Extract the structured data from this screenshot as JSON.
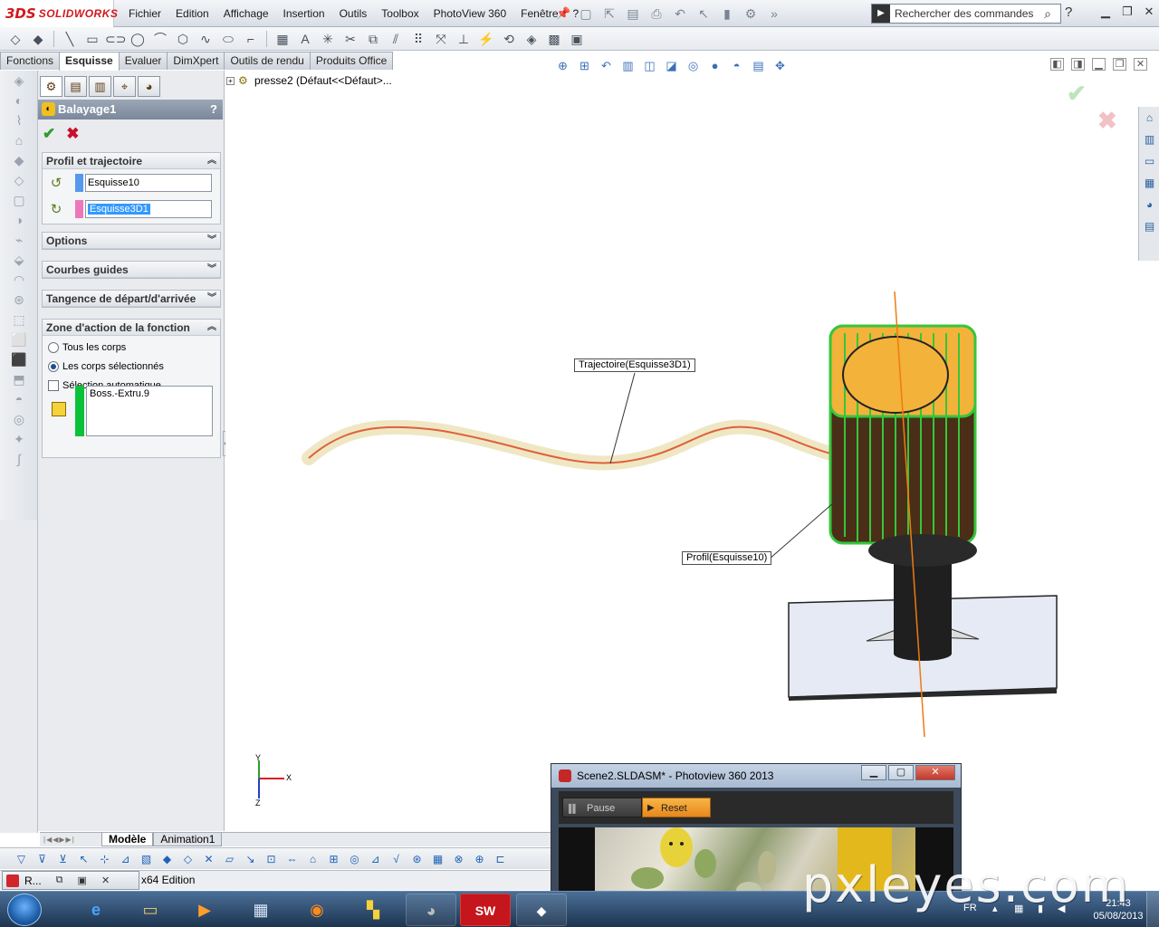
{
  "app": {
    "brand_prefix": "3DS",
    "brand_name": "SOLIDWORKS"
  },
  "menu": {
    "items": [
      "Fichier",
      "Edition",
      "Affichage",
      "Insertion",
      "Outils",
      "Toolbox",
      "PhotoView 360",
      "Fenêtre",
      "?"
    ],
    "more": "»"
  },
  "search": {
    "value": "Rechercher des commandes",
    "help_label": "?"
  },
  "tabs": [
    "Fonctions",
    "Esquisse",
    "Evaluer",
    "DimXpert",
    "Outils de rendu",
    "Produits Office"
  ],
  "active_tab": "Esquisse",
  "property_manager": {
    "title": "Balayage1",
    "help": "?",
    "ok": "✔",
    "cancel": "✖",
    "sections": {
      "profile_path": "Profil et trajectoire",
      "options": "Options",
      "guides": "Courbes guides",
      "tangency": "Tangence de départ/d'arrivée",
      "scope": "Zone d'action de la fonction"
    },
    "profile_value": "Esquisse10",
    "path_value": "Esquisse3D1",
    "profile_color": "#5599ee",
    "path_color": "#ee77bb",
    "scope_options": {
      "all": "Tous les corps",
      "selected": "Les corps sélectionnés",
      "auto": "Sélection automatique"
    },
    "bodies": [
      "Boss.-Extru.9"
    ],
    "bodies_color": "#0cc13a"
  },
  "tree": {
    "label": "presse2  (Défaut<<Défaut>..."
  },
  "callouts": {
    "path": "Trajectoire(Esquisse3D1)",
    "profile": "Profil(Esquisse10)"
  },
  "triad": {
    "x": "X",
    "y": "Y",
    "z": "Z"
  },
  "bottom_tabs": [
    "Modèle",
    "Animation1"
  ],
  "active_bottom_tab": "Modèle",
  "status": {
    "minimized_label": "R...",
    "text": "x64 Edition"
  },
  "photoview": {
    "title": "Scene2.SLDASM* - Photoview 360 2013",
    "pause": "Pause",
    "reset": "Reset"
  },
  "taskbar": {
    "language": "FR",
    "time": "21:43",
    "date": "05/08/2013",
    "apps": [
      "internet-explorer",
      "file-explorer",
      "media-player",
      "calculator",
      "firefox",
      "puzzle-app",
      "gimp",
      "solidworks",
      "solidworks-2"
    ]
  },
  "watermark": "pxleyes.com"
}
